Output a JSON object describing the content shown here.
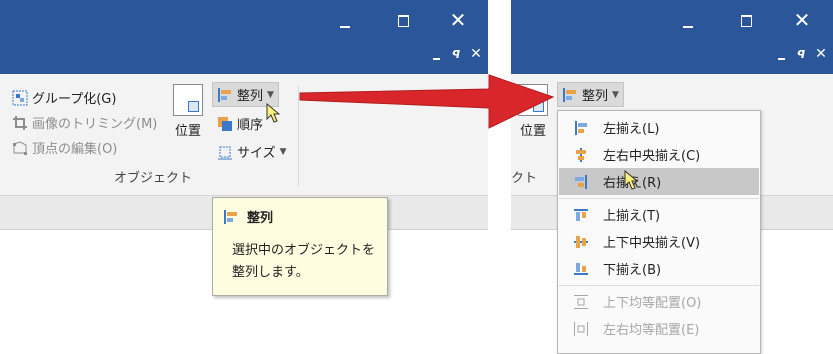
{
  "left": {
    "ribbon": {
      "group_item": "グループ化(G)",
      "crop_item": "画像のトリミング(M)",
      "edit_points_item": "頂点の編集(O)",
      "position_label": "位置",
      "align_label": "整列",
      "order_label": "順序",
      "size_label": "サイズ",
      "group_name": "オブジェクト"
    },
    "tooltip": {
      "title": "整列",
      "line1": "選択中のオブジェクトを",
      "line2": "整列します。"
    }
  },
  "right": {
    "ribbon": {
      "align_label": "整列",
      "position_label": "位置",
      "group_name_partial": "クト"
    },
    "menu": {
      "items": [
        {
          "label": "左揃え(L)",
          "icon": "align-left-icon",
          "state": "normal"
        },
        {
          "label": "左右中央揃え(C)",
          "icon": "align-center-icon",
          "state": "normal"
        },
        {
          "label": "右揃え(R)",
          "icon": "align-right-icon",
          "state": "highlighted"
        },
        {
          "label": "上揃え(T)",
          "icon": "align-top-icon",
          "state": "normal"
        },
        {
          "label": "上下中央揃え(V)",
          "icon": "align-middle-icon",
          "state": "normal"
        },
        {
          "label": "下揃え(B)",
          "icon": "align-bottom-icon",
          "state": "normal"
        },
        {
          "label": "上下均等配置(O)",
          "icon": "distribute-vertical-icon",
          "state": "disabled"
        },
        {
          "label": "左右均等配置(E)",
          "icon": "distribute-horizontal-icon",
          "state": "disabled"
        }
      ]
    }
  },
  "colors": {
    "titlebar": "#2b579a",
    "arrow": "#d9262a",
    "tooltip_bg": "#fffde0",
    "menu_highlight": "#c8c8c8",
    "icon_blue": "#3a78c9",
    "icon_orange": "#e8a24a"
  }
}
